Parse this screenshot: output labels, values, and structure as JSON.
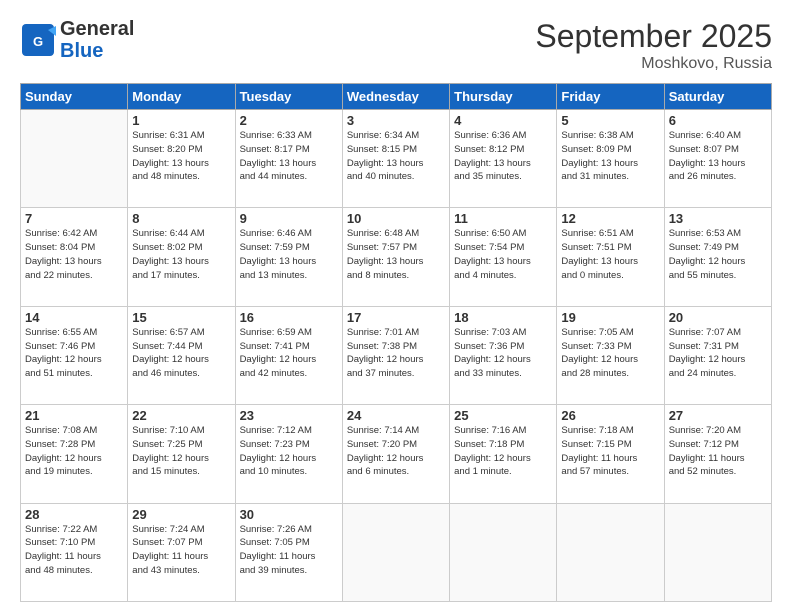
{
  "header": {
    "logo_general": "General",
    "logo_blue": "Blue",
    "month": "September 2025",
    "location": "Moshkovo, Russia"
  },
  "weekdays": [
    "Sunday",
    "Monday",
    "Tuesday",
    "Wednesday",
    "Thursday",
    "Friday",
    "Saturday"
  ],
  "weeks": [
    [
      {
        "day": "",
        "info": ""
      },
      {
        "day": "1",
        "info": "Sunrise: 6:31 AM\nSunset: 8:20 PM\nDaylight: 13 hours\nand 48 minutes."
      },
      {
        "day": "2",
        "info": "Sunrise: 6:33 AM\nSunset: 8:17 PM\nDaylight: 13 hours\nand 44 minutes."
      },
      {
        "day": "3",
        "info": "Sunrise: 6:34 AM\nSunset: 8:15 PM\nDaylight: 13 hours\nand 40 minutes."
      },
      {
        "day": "4",
        "info": "Sunrise: 6:36 AM\nSunset: 8:12 PM\nDaylight: 13 hours\nand 35 minutes."
      },
      {
        "day": "5",
        "info": "Sunrise: 6:38 AM\nSunset: 8:09 PM\nDaylight: 13 hours\nand 31 minutes."
      },
      {
        "day": "6",
        "info": "Sunrise: 6:40 AM\nSunset: 8:07 PM\nDaylight: 13 hours\nand 26 minutes."
      }
    ],
    [
      {
        "day": "7",
        "info": "Sunrise: 6:42 AM\nSunset: 8:04 PM\nDaylight: 13 hours\nand 22 minutes."
      },
      {
        "day": "8",
        "info": "Sunrise: 6:44 AM\nSunset: 8:02 PM\nDaylight: 13 hours\nand 17 minutes."
      },
      {
        "day": "9",
        "info": "Sunrise: 6:46 AM\nSunset: 7:59 PM\nDaylight: 13 hours\nand 13 minutes."
      },
      {
        "day": "10",
        "info": "Sunrise: 6:48 AM\nSunset: 7:57 PM\nDaylight: 13 hours\nand 8 minutes."
      },
      {
        "day": "11",
        "info": "Sunrise: 6:50 AM\nSunset: 7:54 PM\nDaylight: 13 hours\nand 4 minutes."
      },
      {
        "day": "12",
        "info": "Sunrise: 6:51 AM\nSunset: 7:51 PM\nDaylight: 13 hours\nand 0 minutes."
      },
      {
        "day": "13",
        "info": "Sunrise: 6:53 AM\nSunset: 7:49 PM\nDaylight: 12 hours\nand 55 minutes."
      }
    ],
    [
      {
        "day": "14",
        "info": "Sunrise: 6:55 AM\nSunset: 7:46 PM\nDaylight: 12 hours\nand 51 minutes."
      },
      {
        "day": "15",
        "info": "Sunrise: 6:57 AM\nSunset: 7:44 PM\nDaylight: 12 hours\nand 46 minutes."
      },
      {
        "day": "16",
        "info": "Sunrise: 6:59 AM\nSunset: 7:41 PM\nDaylight: 12 hours\nand 42 minutes."
      },
      {
        "day": "17",
        "info": "Sunrise: 7:01 AM\nSunset: 7:38 PM\nDaylight: 12 hours\nand 37 minutes."
      },
      {
        "day": "18",
        "info": "Sunrise: 7:03 AM\nSunset: 7:36 PM\nDaylight: 12 hours\nand 33 minutes."
      },
      {
        "day": "19",
        "info": "Sunrise: 7:05 AM\nSunset: 7:33 PM\nDaylight: 12 hours\nand 28 minutes."
      },
      {
        "day": "20",
        "info": "Sunrise: 7:07 AM\nSunset: 7:31 PM\nDaylight: 12 hours\nand 24 minutes."
      }
    ],
    [
      {
        "day": "21",
        "info": "Sunrise: 7:08 AM\nSunset: 7:28 PM\nDaylight: 12 hours\nand 19 minutes."
      },
      {
        "day": "22",
        "info": "Sunrise: 7:10 AM\nSunset: 7:25 PM\nDaylight: 12 hours\nand 15 minutes."
      },
      {
        "day": "23",
        "info": "Sunrise: 7:12 AM\nSunset: 7:23 PM\nDaylight: 12 hours\nand 10 minutes."
      },
      {
        "day": "24",
        "info": "Sunrise: 7:14 AM\nSunset: 7:20 PM\nDaylight: 12 hours\nand 6 minutes."
      },
      {
        "day": "25",
        "info": "Sunrise: 7:16 AM\nSunset: 7:18 PM\nDaylight: 12 hours\nand 1 minute."
      },
      {
        "day": "26",
        "info": "Sunrise: 7:18 AM\nSunset: 7:15 PM\nDaylight: 11 hours\nand 57 minutes."
      },
      {
        "day": "27",
        "info": "Sunrise: 7:20 AM\nSunset: 7:12 PM\nDaylight: 11 hours\nand 52 minutes."
      }
    ],
    [
      {
        "day": "28",
        "info": "Sunrise: 7:22 AM\nSunset: 7:10 PM\nDaylight: 11 hours\nand 48 minutes."
      },
      {
        "day": "29",
        "info": "Sunrise: 7:24 AM\nSunset: 7:07 PM\nDaylight: 11 hours\nand 43 minutes."
      },
      {
        "day": "30",
        "info": "Sunrise: 7:26 AM\nSunset: 7:05 PM\nDaylight: 11 hours\nand 39 minutes."
      },
      {
        "day": "",
        "info": ""
      },
      {
        "day": "",
        "info": ""
      },
      {
        "day": "",
        "info": ""
      },
      {
        "day": "",
        "info": ""
      }
    ]
  ]
}
